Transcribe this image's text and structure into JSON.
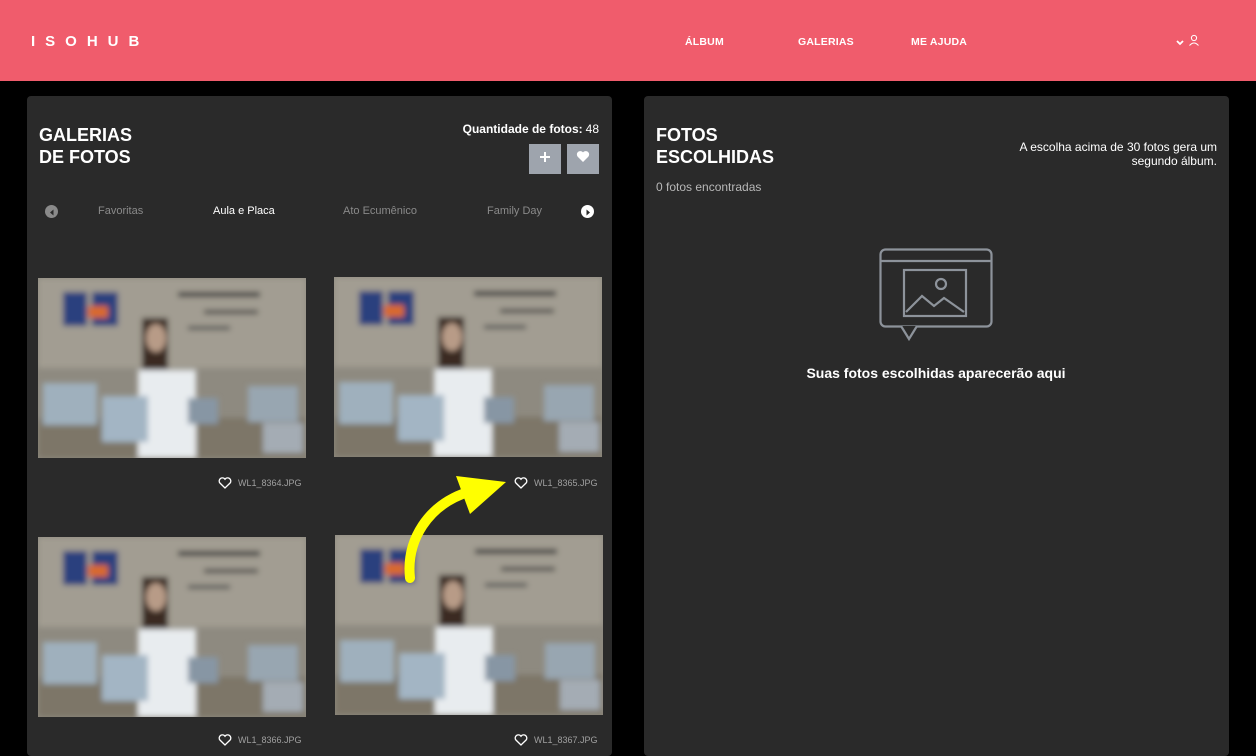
{
  "header": {
    "logo": "ISOHUB",
    "nav": [
      {
        "label": "ÁLBUM"
      },
      {
        "label": "GALERIAS"
      },
      {
        "label": "ME AJUDA"
      }
    ]
  },
  "galleries": {
    "title_line1": "GALERIAS",
    "title_line2": "DE FOTOS",
    "quantity_label": "Quantidade de fotos:",
    "quantity_value": "48",
    "tabs": [
      {
        "label": "Favoritas"
      },
      {
        "label": "Aula e Placa"
      },
      {
        "label": "Ato Ecumênico"
      },
      {
        "label": "Family Day"
      }
    ],
    "active_tab": "Aula e Placa",
    "photos": [
      {
        "filename": "WL1_8364.JPG"
      },
      {
        "filename": "WL1_8365.JPG"
      },
      {
        "filename": "WL1_8366.JPG"
      },
      {
        "filename": "WL1_8367.JPG"
      }
    ]
  },
  "chosen": {
    "title_line1": "FOTOS",
    "title_line2": "ESCOLHIDAS",
    "note": "A escolha acima de 30 fotos gera um segundo álbum.",
    "count": "0 fotos encontradas",
    "empty_message": "Suas fotos escolhidas aparecerão aqui"
  },
  "colors": {
    "brand": "#f05c6c",
    "panel": "#2a2a2a",
    "button": "#9ea4ad",
    "annotation_arrow": "#ffff00"
  },
  "icons": [
    "chevron-down-icon",
    "user-icon",
    "plus-icon",
    "heart-icon",
    "arrow-left-icon",
    "arrow-right-icon",
    "image-placeholder-icon"
  ]
}
